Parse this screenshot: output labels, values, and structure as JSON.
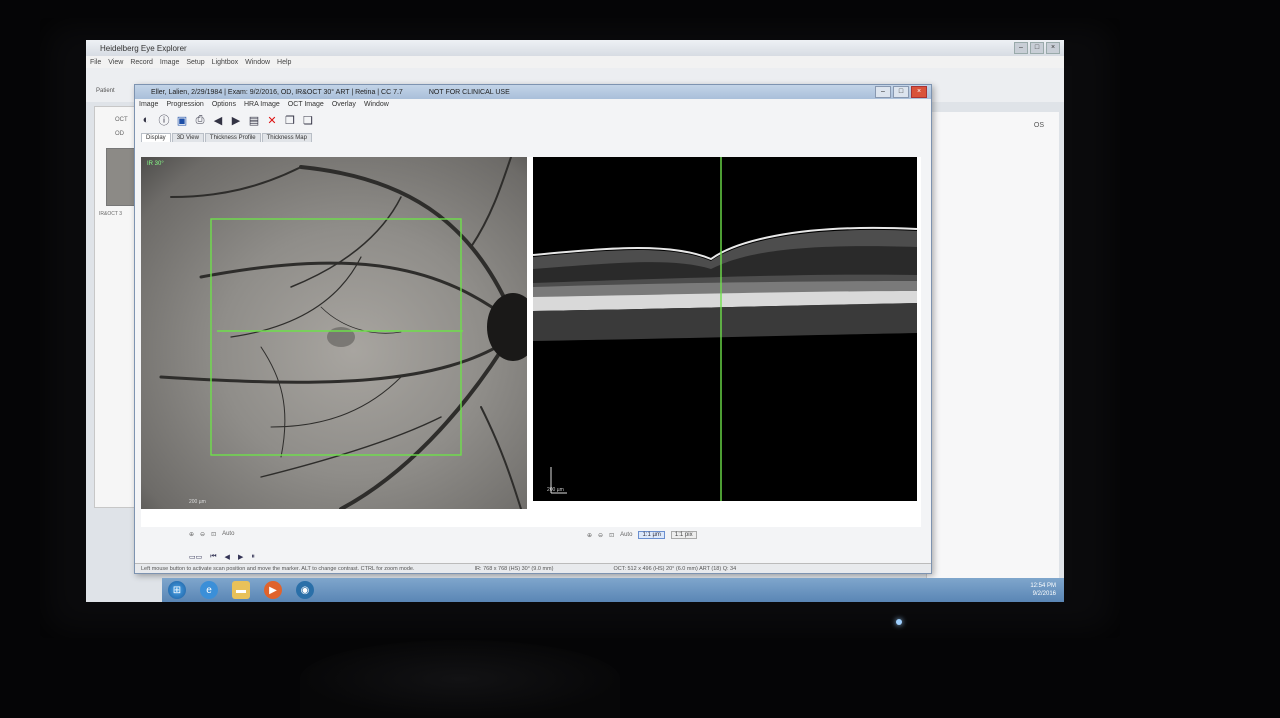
{
  "outer": {
    "title": "Heidelberg Eye Explorer",
    "menu": [
      "File",
      "View",
      "Record",
      "Image",
      "Setup",
      "Lightbox",
      "Window",
      "Help"
    ],
    "patient_label": "Patient",
    "oct_label": "OCT",
    "od_label": "OD",
    "right_od": "OS",
    "thumb_label": "IR&OCT 3"
  },
  "inner": {
    "title": "Eller, Lalien, 2/29/1984  |  Exam: 9/2/2016, OD, IR&OCT 30° ART  |  Retina  |  CC 7.7",
    "not_clinical": "NOT FOR CLINICAL USE",
    "menu": [
      "Image",
      "Progression",
      "Options",
      "HRA Image",
      "OCT Image",
      "Overlay",
      "Window"
    ],
    "tabs": [
      "Display",
      "3D View",
      "Thickness Profile",
      "Thickness Map"
    ],
    "fundus_label": "IR 30°",
    "fundus_scale": "200 µm",
    "oct_scale": "200 µm",
    "zoom_left": "Auto",
    "zoom_right": "Auto",
    "layer_btn_1": "1:1 µm",
    "layer_btn_2": "1:1 pix",
    "status_left": "Left mouse button to activate scan position and move the marker. ALT to change contrast. CTRL for zoom mode.",
    "status_mid": "IR: 768 x 768 (HS) 30° (9.0 mm)",
    "status_right": "OCT: 512 x 496 (HS) 20° (6.0 mm) ART (18) Q: 34"
  },
  "taskbar": {
    "time": "12:54 PM",
    "date": "9/2/2016"
  },
  "colors": {
    "scan_green": "#6ee04a",
    "screen_bg": "#dfe3e8",
    "taskbar": "#5a86b5"
  }
}
